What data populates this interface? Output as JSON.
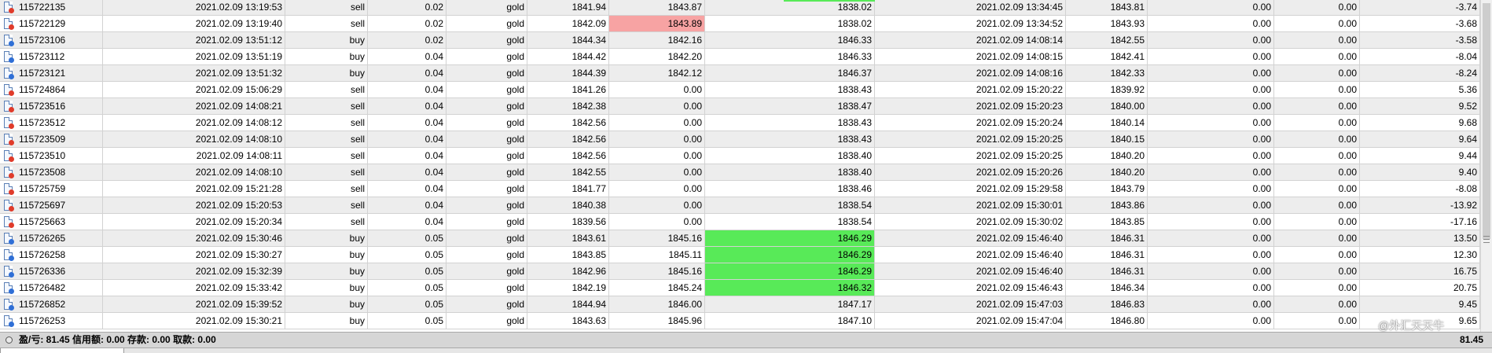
{
  "colors": {
    "loss_highlight": "#f7a3a3",
    "profit_highlight": "#58ea58",
    "stripe": "#ededed"
  },
  "icons": {
    "order_icon": "order-document-icon"
  },
  "rows": [
    [
      "115722135",
      "2021.02.09 13:19:53",
      "sell",
      "0.02",
      "gold",
      "1841.94",
      "1843.87",
      "1838.02",
      "2021.02.09 13:34:45",
      "1843.81",
      "0.00",
      "0.00",
      "-3.74"
    ],
    [
      "115722129",
      "2021.02.09 13:19:40",
      "sell",
      "0.02",
      "gold",
      "1842.09",
      "1843.89",
      "1838.02",
      "2021.02.09 13:34:52",
      "1843.93",
      "0.00",
      "0.00",
      "-3.68"
    ],
    [
      "115723106",
      "2021.02.09 13:51:12",
      "buy",
      "0.02",
      "gold",
      "1844.34",
      "1842.16",
      "1846.33",
      "2021.02.09 14:08:14",
      "1842.55",
      "0.00",
      "0.00",
      "-3.58"
    ],
    [
      "115723112",
      "2021.02.09 13:51:19",
      "buy",
      "0.04",
      "gold",
      "1844.42",
      "1842.20",
      "1846.33",
      "2021.02.09 14:08:15",
      "1842.41",
      "0.00",
      "0.00",
      "-8.04"
    ],
    [
      "115723121",
      "2021.02.09 13:51:32",
      "buy",
      "0.04",
      "gold",
      "1844.39",
      "1842.12",
      "1846.37",
      "2021.02.09 14:08:16",
      "1842.33",
      "0.00",
      "0.00",
      "-8.24"
    ],
    [
      "115724864",
      "2021.02.09 15:06:29",
      "sell",
      "0.04",
      "gold",
      "1841.26",
      "0.00",
      "1838.43",
      "2021.02.09 15:20:22",
      "1839.92",
      "0.00",
      "0.00",
      "5.36"
    ],
    [
      "115723516",
      "2021.02.09 14:08:21",
      "sell",
      "0.04",
      "gold",
      "1842.38",
      "0.00",
      "1838.47",
      "2021.02.09 15:20:23",
      "1840.00",
      "0.00",
      "0.00",
      "9.52"
    ],
    [
      "115723512",
      "2021.02.09 14:08:12",
      "sell",
      "0.04",
      "gold",
      "1842.56",
      "0.00",
      "1838.43",
      "2021.02.09 15:20:24",
      "1840.14",
      "0.00",
      "0.00",
      "9.68"
    ],
    [
      "115723509",
      "2021.02.09 14:08:10",
      "sell",
      "0.04",
      "gold",
      "1842.56",
      "0.00",
      "1838.43",
      "2021.02.09 15:20:25",
      "1840.15",
      "0.00",
      "0.00",
      "9.64"
    ],
    [
      "115723510",
      "2021.02.09 14:08:11",
      "sell",
      "0.04",
      "gold",
      "1842.56",
      "0.00",
      "1838.40",
      "2021.02.09 15:20:25",
      "1840.20",
      "0.00",
      "0.00",
      "9.44"
    ],
    [
      "115723508",
      "2021.02.09 14:08:10",
      "sell",
      "0.04",
      "gold",
      "1842.55",
      "0.00",
      "1838.40",
      "2021.02.09 15:20:26",
      "1840.20",
      "0.00",
      "0.00",
      "9.40"
    ],
    [
      "115725759",
      "2021.02.09 15:21:28",
      "sell",
      "0.04",
      "gold",
      "1841.77",
      "0.00",
      "1838.46",
      "2021.02.09 15:29:58",
      "1843.79",
      "0.00",
      "0.00",
      "-8.08"
    ],
    [
      "115725697",
      "2021.02.09 15:20:53",
      "sell",
      "0.04",
      "gold",
      "1840.38",
      "0.00",
      "1838.54",
      "2021.02.09 15:30:01",
      "1843.86",
      "0.00",
      "0.00",
      "-13.92"
    ],
    [
      "115725663",
      "2021.02.09 15:20:34",
      "sell",
      "0.04",
      "gold",
      "1839.56",
      "0.00",
      "1838.54",
      "2021.02.09 15:30:02",
      "1843.85",
      "0.00",
      "0.00",
      "-17.16"
    ],
    [
      "115726265",
      "2021.02.09 15:30:46",
      "buy",
      "0.05",
      "gold",
      "1843.61",
      "1845.16",
      "1846.29",
      "2021.02.09 15:46:40",
      "1846.31",
      "0.00",
      "0.00",
      "13.50"
    ],
    [
      "115726258",
      "2021.02.09 15:30:27",
      "buy",
      "0.05",
      "gold",
      "1843.85",
      "1845.11",
      "1846.29",
      "2021.02.09 15:46:40",
      "1846.31",
      "0.00",
      "0.00",
      "12.30"
    ],
    [
      "115726336",
      "2021.02.09 15:32:39",
      "buy",
      "0.05",
      "gold",
      "1842.96",
      "1845.16",
      "1846.29",
      "2021.02.09 15:46:40",
      "1846.31",
      "0.00",
      "0.00",
      "16.75"
    ],
    [
      "115726482",
      "2021.02.09 15:33:42",
      "buy",
      "0.05",
      "gold",
      "1842.19",
      "1845.24",
      "1846.32",
      "2021.02.09 15:46:43",
      "1846.34",
      "0.00",
      "0.00",
      "20.75"
    ],
    [
      "115726852",
      "2021.02.09 15:39:52",
      "buy",
      "0.05",
      "gold",
      "1844.94",
      "1846.00",
      "1847.17",
      "2021.02.09 15:47:03",
      "1846.83",
      "0.00",
      "0.00",
      "9.45"
    ],
    [
      "115726253",
      "2021.02.09 15:30:21",
      "buy",
      "0.05",
      "gold",
      "1843.63",
      "1845.96",
      "1847.10",
      "2021.02.09 15:47:04",
      "1846.80",
      "0.00",
      "0.00",
      "9.65"
    ]
  ],
  "highlights": [
    {
      "row": 1,
      "col": 6,
      "kind": "loss"
    },
    {
      "row": 14,
      "col": 7,
      "kind": "profit"
    },
    {
      "row": 15,
      "col": 7,
      "kind": "profit"
    },
    {
      "row": 16,
      "col": 7,
      "kind": "profit"
    },
    {
      "row": 17,
      "col": 7,
      "kind": "profit"
    }
  ],
  "status": {
    "summary": "盈/亏: 81.45  信用额: 0.00  存款: 0.00  取款: 0.00",
    "total": "81.45"
  },
  "watermark": "@外汇天天牛"
}
